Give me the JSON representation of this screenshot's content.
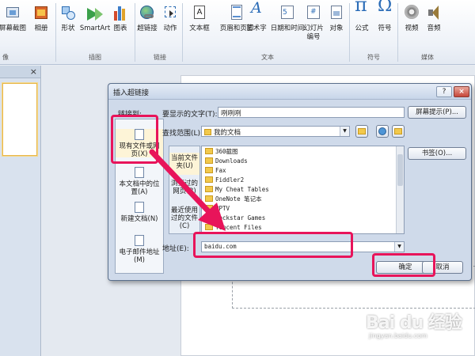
{
  "ribbon": {
    "buttons": [
      {
        "label": "屏幕截图",
        "icon": "screenshot-icon"
      },
      {
        "label": "相册",
        "icon": "photo-album-icon"
      },
      {
        "label": "形状",
        "icon": "shapes-icon"
      },
      {
        "label": "SmartArt",
        "icon": "smartart-icon"
      },
      {
        "label": "图表",
        "icon": "chart-icon"
      },
      {
        "label": "超链接",
        "icon": "hyperlink-icon"
      },
      {
        "label": "动作",
        "icon": "action-icon"
      },
      {
        "label": "文本框",
        "icon": "textbox-icon"
      },
      {
        "label": "页眉和页脚",
        "icon": "header-footer-icon"
      },
      {
        "label": "艺术字",
        "icon": "wordart-icon"
      },
      {
        "label": "日期和时间",
        "icon": "date-time-icon"
      },
      {
        "label": "幻灯片",
        "label2": "编号",
        "icon": "slide-number-icon"
      },
      {
        "label": "对象",
        "icon": "object-icon"
      },
      {
        "label": "公式",
        "icon": "equation-icon"
      },
      {
        "label": "符号",
        "icon": "symbol-icon"
      },
      {
        "label": "视频",
        "icon": "video-icon"
      },
      {
        "label": "音频",
        "icon": "audio-icon"
      }
    ],
    "groups": {
      "images_partial": "像",
      "illustrations": "插图",
      "links": "链接",
      "text": "文本",
      "symbols": "符号",
      "media": "媒体"
    }
  },
  "dialog": {
    "title": "插入超链接",
    "help": "?",
    "close": "×",
    "link_to_label": "链接到:",
    "display_text_label": "要显示的文字(T):",
    "display_text_value": "咧咧咧",
    "screen_tip_button": "屏幕提示(P)...",
    "look_in_label": "查找范围(L):",
    "look_in_value": "我的文档",
    "bookmark_button": "书签(O)...",
    "address_label": "地址(E):",
    "address_value": "baidu.com",
    "ok_button": "确定",
    "cancel_button": "取消",
    "link_targets": [
      {
        "line1": "现有文件或网",
        "line2": "页(X)"
      },
      {
        "line1": "本文档中的位",
        "line2": "置(A)"
      },
      {
        "line1": "新建文档(N)",
        "line2": ""
      },
      {
        "line1": "电子邮件地址",
        "line2": "(M)"
      }
    ],
    "folder_tabs": [
      {
        "line1": "当前文件",
        "line2": "夹(U)"
      },
      {
        "line1": "浏览过的",
        "line2": "网页(B)"
      },
      {
        "line1": "最近使用",
        "line2": "过的文件",
        "line3": "(C)"
      }
    ],
    "files": [
      "360截图",
      "Downloads",
      "Fax",
      "Fiddler2",
      "My Cheat Tables",
      "OneNote 笔记本",
      "PPTV",
      "Rockstar Games",
      "Tencent Files"
    ]
  },
  "watermark": {
    "brand": "Bai du 经验",
    "url": "jingyan.baidu.com"
  },
  "colors": {
    "highlight": "#e8145a",
    "ribbon_bg": "#eef2f8",
    "dialog_bg": "#cfdaea"
  }
}
